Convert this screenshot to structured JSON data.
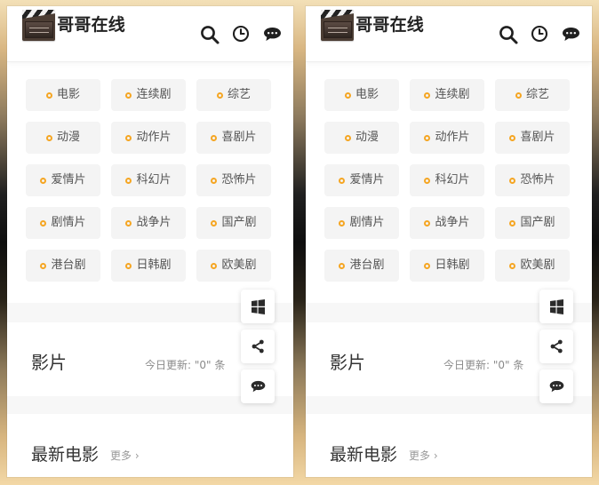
{
  "brand": {
    "name": "哥哥在线",
    "logo_icon": "clapperboard-icon"
  },
  "header": {
    "icons": {
      "search": "search-icon",
      "history": "clock-icon",
      "message": "chat-icon"
    }
  },
  "categories": [
    "电影",
    "连续剧",
    "综艺",
    "动漫",
    "动作片",
    "喜剧片",
    "爱情片",
    "科幻片",
    "恐怖片",
    "剧情片",
    "战争片",
    "国产剧",
    "港台剧",
    "日韩剧",
    "欧美剧"
  ],
  "films_section": {
    "title": "影片",
    "update_prefix": "今日更新:",
    "update_count": "\"0\"",
    "update_suffix": "条"
  },
  "latest_section": {
    "title": "最新电影",
    "more": "更多 ›"
  },
  "floating_tools": {
    "windows": "windows-icon",
    "share": "share-icon",
    "message": "chat-icon"
  },
  "colors": {
    "accent": "#f5a623",
    "text": "#333333",
    "muted": "#999999",
    "panel_bg": "#ffffff",
    "item_bg": "#f4f4f4"
  }
}
